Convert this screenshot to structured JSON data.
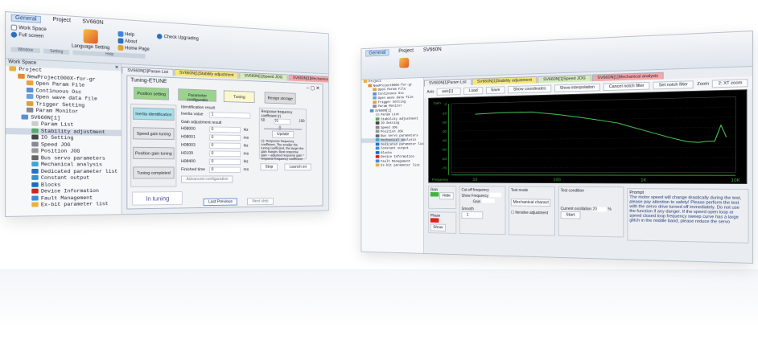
{
  "left_window": {
    "ribbon_tabs": [
      "General",
      "Project",
      "SV660N"
    ],
    "ribbon": {
      "work_space": "Work Space",
      "full_screen": "Full screen",
      "language": "Language Setting",
      "help": "Help",
      "about": "About",
      "home_page": "Home Page",
      "check_upgrade": "Check Upgrading",
      "groups": [
        "Window",
        "Setting",
        "Help"
      ]
    },
    "workspace_title": "Work Space",
    "tree": [
      "Project",
      "NewProject000X-for-gr",
      "Open Param File",
      "Continuous Osc",
      "Open wave data file",
      "Trigger Setting",
      "Param Monitor",
      "SV660N[1]",
      "Param List",
      "Stability adjustment",
      "IO Setting",
      "Speed JOG",
      "Position JOG",
      "Bus servo parameters",
      "Mechanical analysis",
      "Dedicated parameter list",
      "Constant output",
      "Blocks",
      "Device Information",
      "Fault Management",
      "Ex-bit parameter list"
    ],
    "tabs": [
      "SV660N[1]Param List",
      "SV660N[1]Stability adjustment",
      "SV660N[1]Speed JOG",
      "SV660N[1]Mechanical analysis"
    ],
    "dialog": {
      "title": "Tuning-ETUNE",
      "steps": [
        "Position setting",
        "Parameter configuratio",
        "Tuning",
        "Resign storage"
      ],
      "left_steps": [
        "Inertia identification",
        "Speed gain tuning",
        "Position gain tuning",
        "Tuning completed"
      ],
      "ident_title": "Identification result",
      "inertia_label": "Inertia value",
      "inertia_value": "1",
      "gain_title": "Gain adjustment result",
      "gains": [
        {
          "name": "H08000",
          "value": "0",
          "unit": "Hz"
        },
        {
          "name": "H08001",
          "value": "0",
          "unit": "ms"
        },
        {
          "name": "H08003",
          "value": "0",
          "unit": "Hz"
        },
        {
          "name": "H0109",
          "value": "0",
          "unit": "ms"
        },
        {
          "name": "H08400",
          "value": "0",
          "unit": "Hz"
        },
        {
          "name": "Finished time",
          "value": "0",
          "unit": "ms"
        }
      ],
      "advanced_btn": "Advanced configuration",
      "resp_title": "Response frequency coefficient (r)",
      "resp_value": "70",
      "slider_min": "50",
      "slider_max": "100",
      "update": "Update",
      "note": "(r): Response frequency coefficient. The smaller the tuning coefficient, the larger the gain margin; Best response gain = adjusted response gain * response frequency coefficient",
      "stop": "Stop",
      "launch": "Launch on",
      "status": "In tuning",
      "prev": "Last Previous",
      "next": "Next step"
    }
  },
  "right_window": {
    "ribbon_tabs": [
      "General",
      "Project",
      "SV660N"
    ],
    "tabs": [
      "SV660N[1]Param List",
      "SV660N[1]Stability adjustment",
      "SV660N[1]Speed JOG",
      "SV660N[1]Mechanical analysis"
    ],
    "toolbar": {
      "axis_label": "Axis",
      "axis_value": "axis[1]",
      "load": "Load",
      "save": "Save",
      "show_coord": "Show coordinates",
      "show_interp": "Show interpolation",
      "cancel_notch": "Cancel notch filter",
      "set_notch": "Set notch filter",
      "zoom": "Zoom",
      "zoom_value": "2: XT zoom"
    },
    "chart_data": {
      "type": "line",
      "xlabel": "Frequency",
      "ylabel": "Gain",
      "xscale": "log",
      "xticks": [
        "10",
        "100",
        "1K",
        "10K"
      ],
      "yticks": [
        "0",
        "-10",
        "-20",
        "-30",
        "-40",
        "-50",
        "-60",
        "-70"
      ],
      "x": [
        10,
        20,
        50,
        100,
        200,
        500,
        1000,
        2000,
        3000,
        4000,
        5000,
        6000,
        7000,
        8000
      ],
      "y": [
        -12,
        -11,
        -11,
        -14,
        -18,
        -24,
        -32,
        -40,
        -44,
        -45,
        -44,
        -44,
        -28,
        -40
      ],
      "color": "#4fd35a"
    },
    "controls": {
      "gain": "Gain",
      "hide": "Hide",
      "phase": "Phase",
      "show": "Show",
      "cutoff": "Cut-off frequency",
      "show_chk": "Show",
      "frequency": "Frequency",
      "gain2": "Gain",
      "smooth": "Smooth",
      "smooth_value": "1",
      "test_mode": "Test mode",
      "mode_value": "Mechanical charact",
      "iterative": "Iterative adjustment",
      "test_cond": "Test condition",
      "current_osc": "Current oscillation",
      "current_value": "20",
      "percent": "%",
      "start": "Start",
      "prompt_title": "Prompt",
      "prompt": "The motor speed will change drastically during the test, please pay attention to safety! Please perform the test with the servo drive turned off immediately. Do not use the function if any danger. If the speed open loop or speed closed loop frequency sweep curve has a large glitch in the middle band, please reduce the servo"
    },
    "colors": {
      "gain": "#3db83d",
      "phase": "#e02020"
    }
  }
}
